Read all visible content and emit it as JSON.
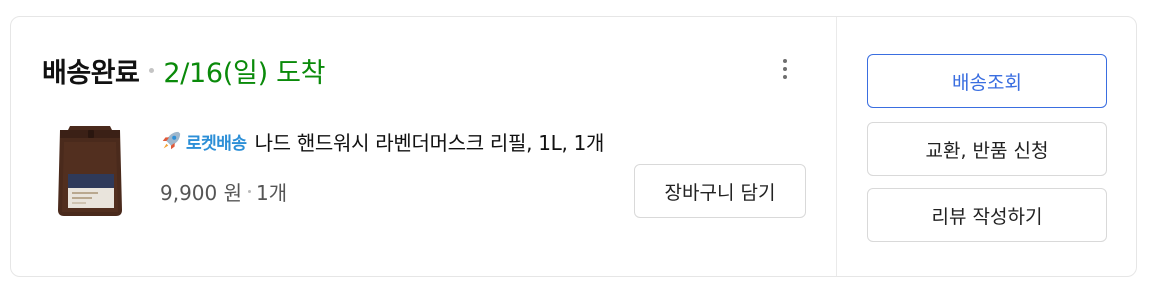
{
  "order": {
    "status_title": "배송완료",
    "arrival_text": "2/16(일) 도착",
    "status_color": "#0a8a0a"
  },
  "product": {
    "delivery_badge": "로켓배송",
    "delivery_badge_icon": "rocket-icon",
    "delivery_badge_color": "#2c8fd7",
    "name": "나드 핸드워시 라벤더머스크 리필, 1L, 1개",
    "price": "9,900 원",
    "quantity": "1개",
    "thumbnail_icon": "refill-pouch-image"
  },
  "actions": {
    "more_icon": "kebab-menu-icon",
    "add_to_cart": "장바구니 담기",
    "track_delivery": "배송조회",
    "exchange_return": "교환, 반품 신청",
    "write_review": "리뷰 작성하기",
    "primary_color": "#3a6ee0"
  }
}
